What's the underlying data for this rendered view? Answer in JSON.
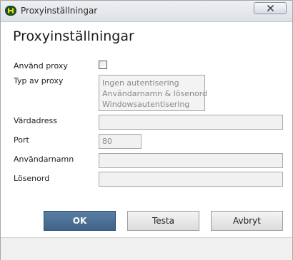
{
  "window": {
    "title": "Proxyinställningar",
    "close_icon": "close-icon",
    "app_icon": "app-logo-icon"
  },
  "dialog": {
    "heading": "Proxyinställningar"
  },
  "form": {
    "use_proxy": {
      "label": "Använd proxy",
      "checked": false
    },
    "proxy_type": {
      "label": "Typ av proxy",
      "options": [
        "Ingen autentisering",
        "Användarnamn & lösenord",
        "Windowsautentisering"
      ]
    },
    "host": {
      "label": "Värdadress",
      "value": ""
    },
    "port": {
      "label": "Port",
      "value": "80"
    },
    "username": {
      "label": "Användarnamn",
      "value": ""
    },
    "password": {
      "label": "Lösenord",
      "value": ""
    }
  },
  "buttons": {
    "ok": "OK",
    "test": "Testa",
    "cancel": "Avbryt"
  },
  "colors": {
    "primary_button": "#4a6f94",
    "disabled_field": "#f1f1f1",
    "disabled_text": "#8a8a8a"
  }
}
